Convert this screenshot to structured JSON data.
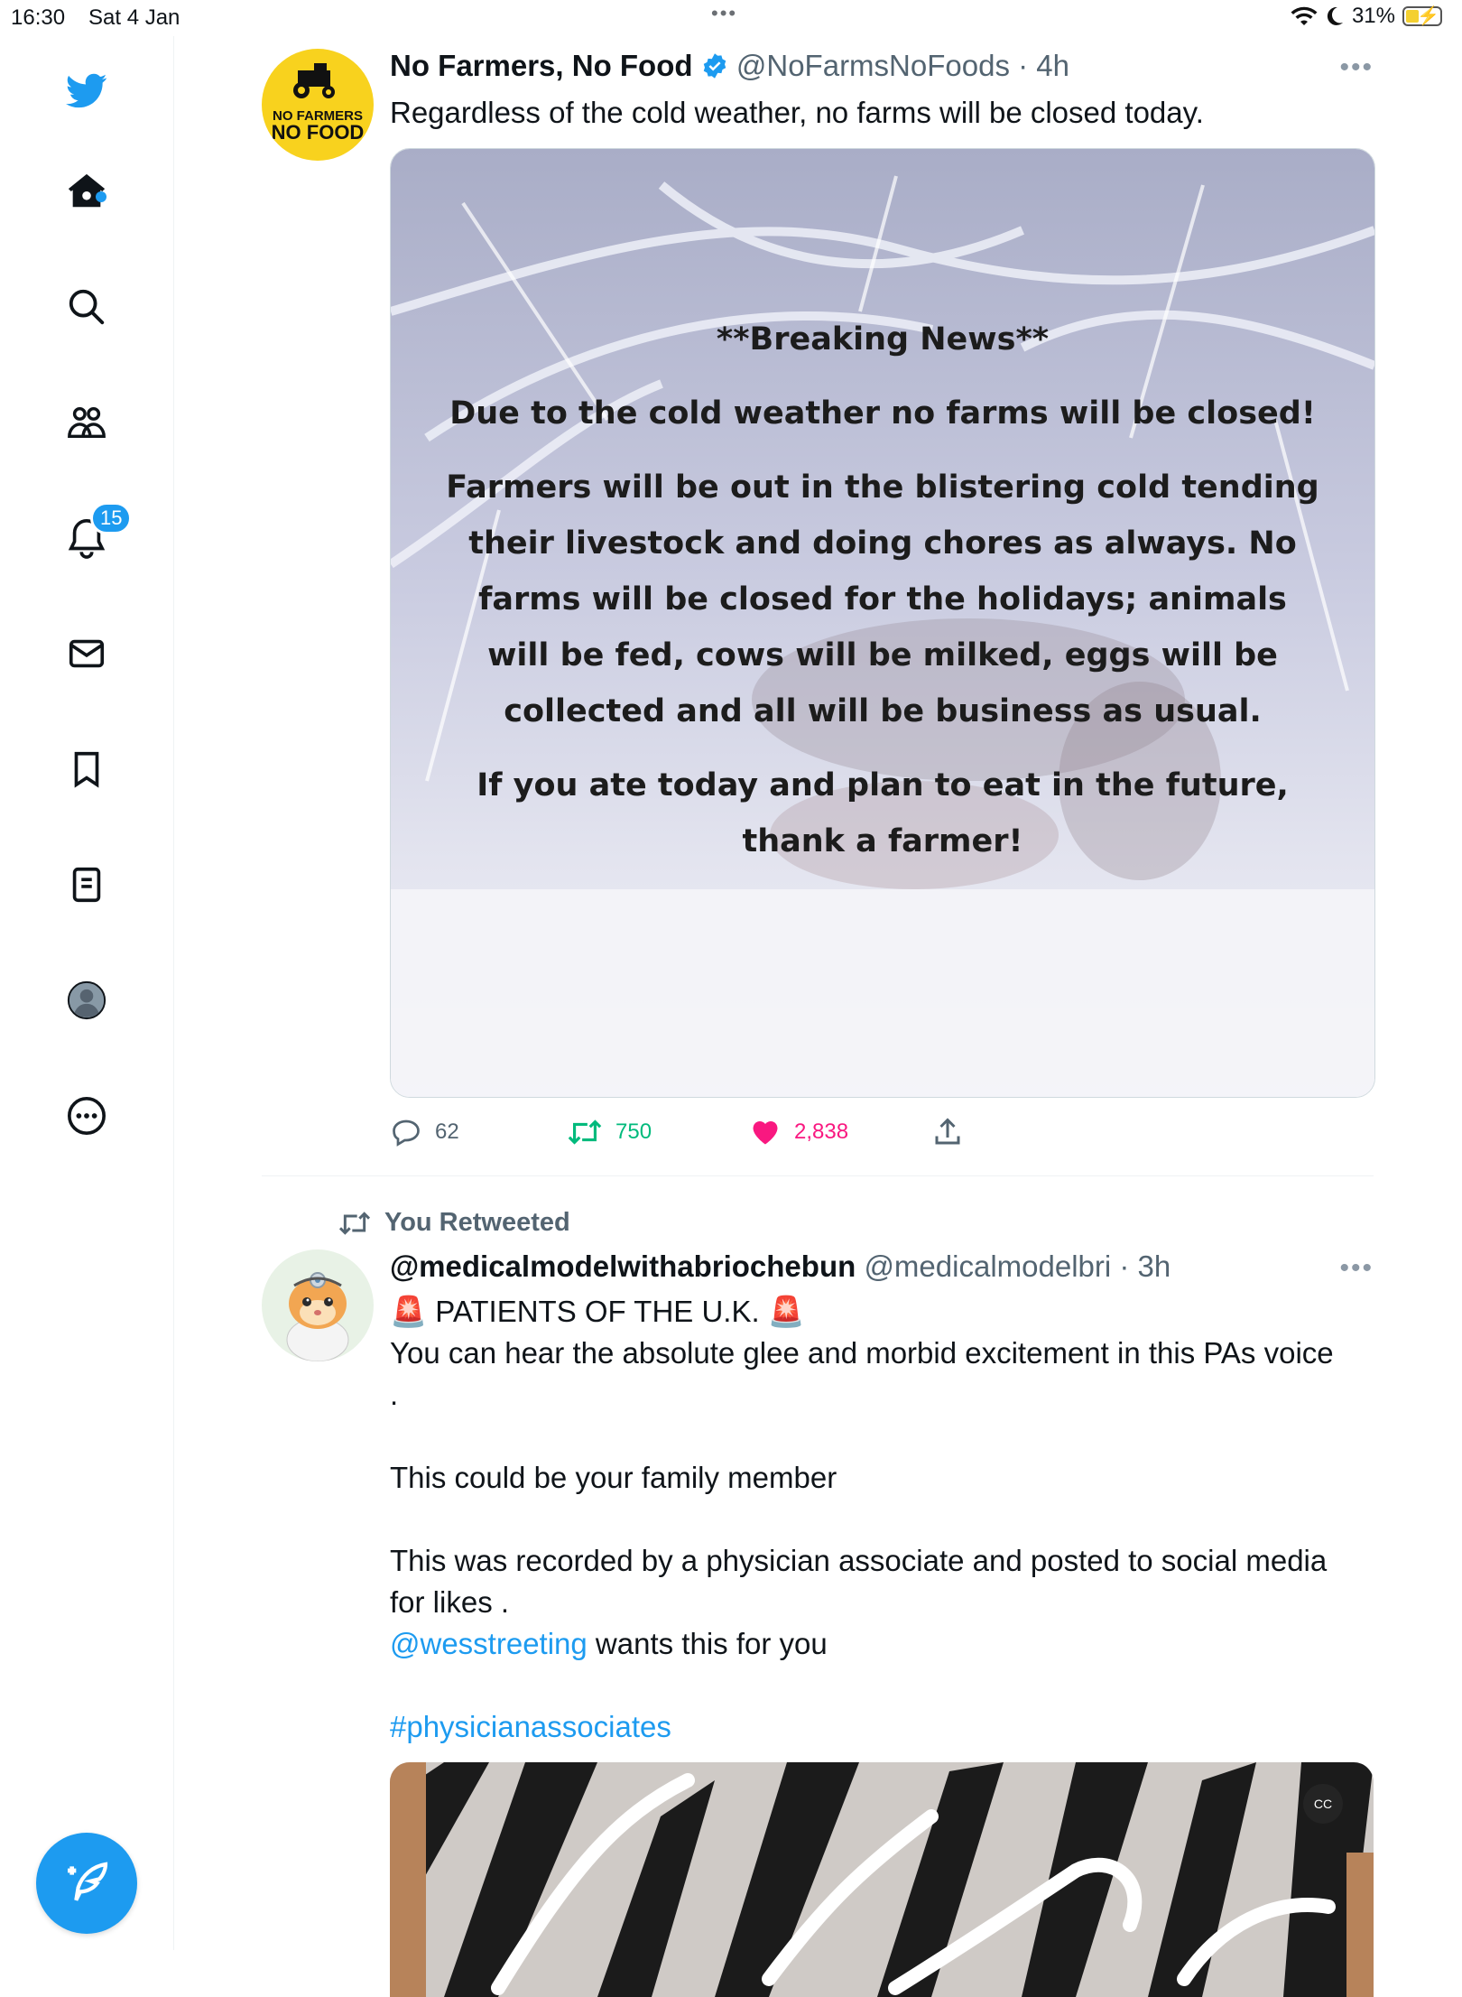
{
  "status_bar": {
    "time": "16:30",
    "date": "Sat 4 Jan",
    "battery": "31%"
  },
  "sidebar": {
    "icons": [
      "twitter-logo-icon",
      "home-icon",
      "search-icon",
      "communities-icon",
      "notifications-icon",
      "messages-icon",
      "bookmarks-icon",
      "lists-icon",
      "profile-icon",
      "more-icon"
    ],
    "notification_count": "15",
    "accent": "#1d9bf0"
  },
  "tweets": [
    {
      "name": "No Farmers, No Food",
      "handle": "@NoFarmsNoFoods",
      "time": "· 4h",
      "verified": true,
      "avatar_text_top": "NO FARMERS",
      "avatar_text_bottom": "NO FOOD",
      "text": "Regardless of the cold weather, no farms will be closed today.",
      "image_text": [
        "**Breaking News**",
        "Due to the cold weather no farms will be closed!",
        "Farmers will be out in the blistering cold tending their livestock and doing chores as always. No farms will be closed for the holidays; animals will be fed, cows will be milked, eggs will be collected and all will be business as usual.",
        "If you ate today and plan to eat in the future, thank a farmer!"
      ],
      "replies": "62",
      "retweets": "750",
      "likes": "2,838"
    },
    {
      "retweeted_label": "You Retweeted",
      "name": "@medicalmodelwithabriochebun",
      "handle": "@medicalmodelbri",
      "time": "· 3h",
      "line1": "🚨 PATIENTS OF THE U.K. 🚨",
      "line2": "You can hear the absolute glee and morbid excitement in this PAs voice",
      "line3": ".",
      "line4": "This could be your family member",
      "line5a": "This was recorded by a physician associate and posted to social media",
      "line5b": "for likes .",
      "mention": "@wesstreeting",
      "mention_rest": " wants this for you",
      "hashtag": "#physicianassociates"
    }
  ]
}
